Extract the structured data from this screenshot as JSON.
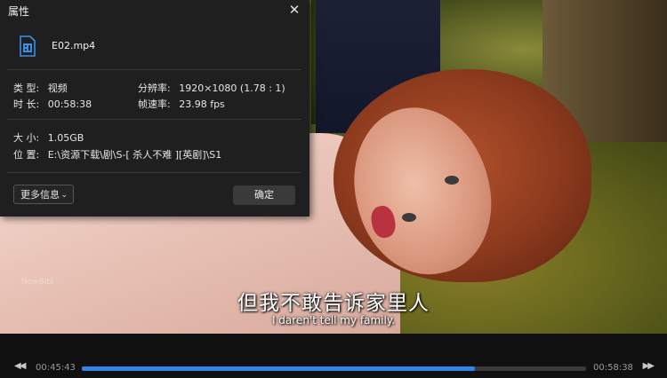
{
  "dialog": {
    "title": "属性",
    "close_glyph": "✕",
    "file": {
      "name": "E02.mp4",
      "icon": "video-file-icon"
    },
    "type_label": "类 型:",
    "type_value": "视频",
    "duration_label": "时 长:",
    "duration_value": "00:58:38",
    "resolution_label": "分辨率:",
    "resolution_value": "1920×1080 (1.78 : 1)",
    "framerate_label": "帧速率:",
    "framerate_value": "23.98 fps",
    "size_label": "大 小:",
    "size_value": "1.05GB",
    "location_label": "位 置:",
    "location_value": "E:\\资源下载\\剧\\S-[ 杀人不难 ][英剧]\\S1",
    "more_info_label": "更多信息",
    "ok_label": "确定"
  },
  "video": {
    "watermark": "NowBits",
    "subtitle_cn": "但我不敢告诉家里人",
    "subtitle_en": "I daren't tell my family."
  },
  "controls": {
    "rewind_glyph": "◀◀",
    "forward_glyph": "▶▶",
    "current_time": "00:45:43",
    "total_time": "00:58:38",
    "progress": 0.78
  },
  "colors": {
    "accent": "#2f85e8",
    "dialog_bg": "#1f1f1f",
    "control_bar_bg": "#101010"
  }
}
